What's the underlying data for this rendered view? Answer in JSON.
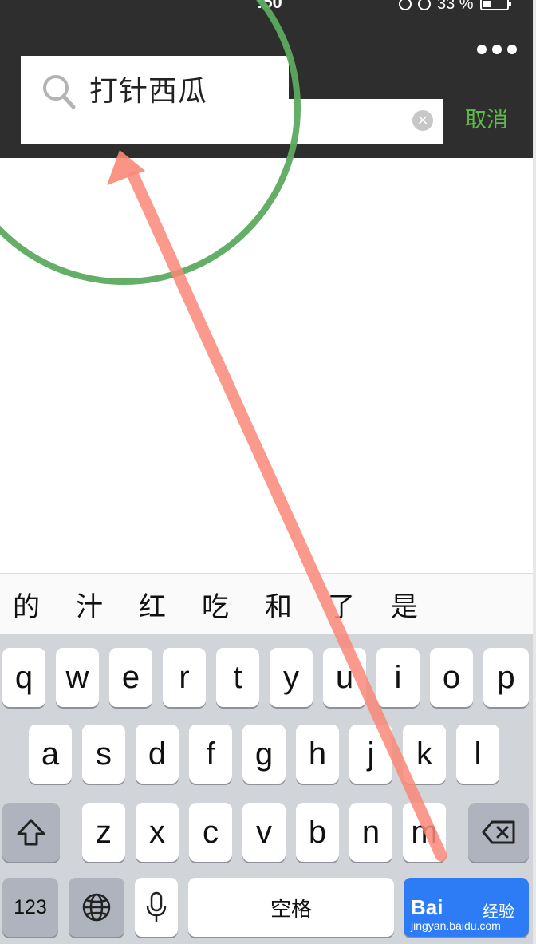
{
  "status_bar": {
    "time": ":50",
    "battery": "33 %"
  },
  "header": {
    "cancel_label": "取消",
    "clear_symbol": "×",
    "more_icon": "more-dots-icon"
  },
  "search": {
    "query": "打针西瓜",
    "icon": "search-icon"
  },
  "candidates": [
    "的",
    "汁",
    "红",
    "吃",
    "和",
    "了",
    "是"
  ],
  "keyboard": {
    "row1": [
      "q",
      "w",
      "e",
      "r",
      "t",
      "y",
      "u",
      "i",
      "o",
      "p"
    ],
    "row2": [
      "a",
      "s",
      "d",
      "f",
      "g",
      "h",
      "j",
      "k",
      "l"
    ],
    "row3": [
      "z",
      "x",
      "c",
      "v",
      "b",
      "n",
      "m"
    ],
    "numbers_label": "123",
    "space_label": "空格",
    "shift_icon": "shift-icon",
    "delete_icon": "backspace-icon",
    "globe_icon": "globe-icon",
    "mic_icon": "microphone-icon"
  },
  "watermark": {
    "brand": "Bai",
    "suffix": "经验",
    "url": "jingyan.baidu.com"
  },
  "colors": {
    "header_bg": "#2e2e2e",
    "cancel_green": "#5fbb49",
    "annotation_circle": "#5daa5f",
    "annotation_arrow": "#fa8878",
    "keyboard_bg": "#d1d4d9",
    "return_key_blue": "#2d7cf6"
  }
}
